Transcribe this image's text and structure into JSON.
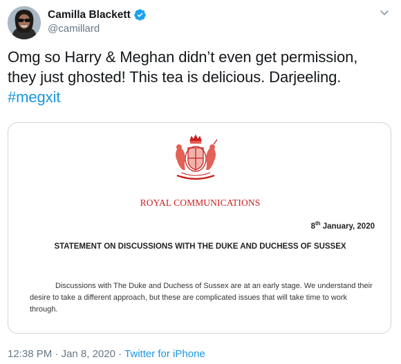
{
  "author": {
    "display_name": "Camilla Blackett",
    "handle": "@camillard"
  },
  "tweet": {
    "text_main": "Omg so Harry & Meghan didn’t even get permission, they just ghosted! This tea is delicious. Darjeeling.",
    "hashtag": "#megxit"
  },
  "card": {
    "header": "ROYAL COMMUNICATIONS",
    "date_day": "8",
    "date_suffix": "th",
    "date_rest": " January, 2020",
    "title": "STATEMENT ON DISCUSSIONS WITH THE DUKE AND DUCHESS OF SUSSEX",
    "body": "Discussions with The Duke and Duchess of Sussex are at an early stage. We understand their desire to take a different approach, but these are complicated issues that will take time to work through."
  },
  "meta": {
    "time": "12:38 PM",
    "separator": "·",
    "date": "Jan 8, 2020",
    "source": "Twitter for iPhone"
  },
  "colors": {
    "link": "#1b95e0",
    "crest": "#c8201e",
    "verified": "#1da1f2"
  },
  "icons": [
    "verified-badge-icon",
    "chevron-down-icon",
    "royal-crest-icon"
  ]
}
